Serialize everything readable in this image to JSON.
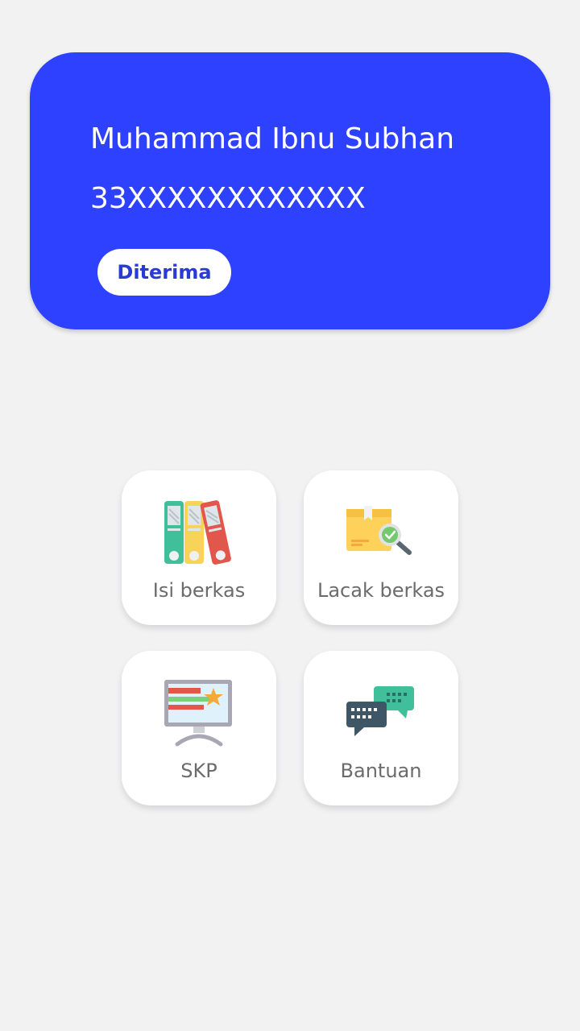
{
  "profile": {
    "name": "Muhammad Ibnu Subhan",
    "nip": "33XXXXXXXXXXXX",
    "status": "Diterima"
  },
  "menu": [
    {
      "label": "Isi berkas",
      "icon": "binders-icon"
    },
    {
      "label": "Lacak berkas",
      "icon": "track-package-icon"
    },
    {
      "label": "SKP",
      "icon": "monitor-chart-icon"
    },
    {
      "label": "Bantuan",
      "icon": "chat-bubbles-icon"
    }
  ],
  "colors": {
    "primary": "#2d41ff",
    "background": "#f2f2f3",
    "tile": "#ffffff",
    "label": "#6b6b6b",
    "badge_text": "#2a3ad6"
  }
}
